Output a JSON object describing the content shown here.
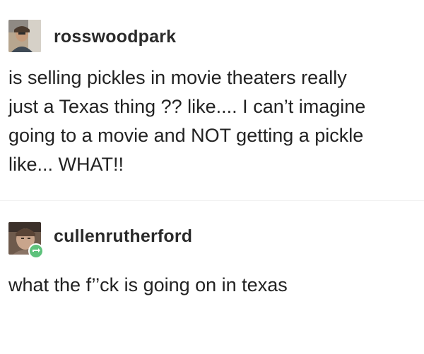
{
  "posts": [
    {
      "username": "rosswoodpark",
      "avatar_icon": "user-avatar-icon",
      "lines": [
        "is selling pickles in movie theaters really",
        "just a Texas thing ?? like.... I can’t imagine",
        "going to a movie and NOT getting a pickle",
        "like... WHAT!!"
      ]
    },
    {
      "username": "cullenrutherford",
      "avatar_icon": "user-avatar-icon",
      "badge_icon": "reblog-icon",
      "lines": [
        "what the f’’ck is going on in texas"
      ]
    }
  ],
  "colors": {
    "background": "#ffffff",
    "text": "#222222",
    "reblog_badge": "#5ec27c"
  }
}
